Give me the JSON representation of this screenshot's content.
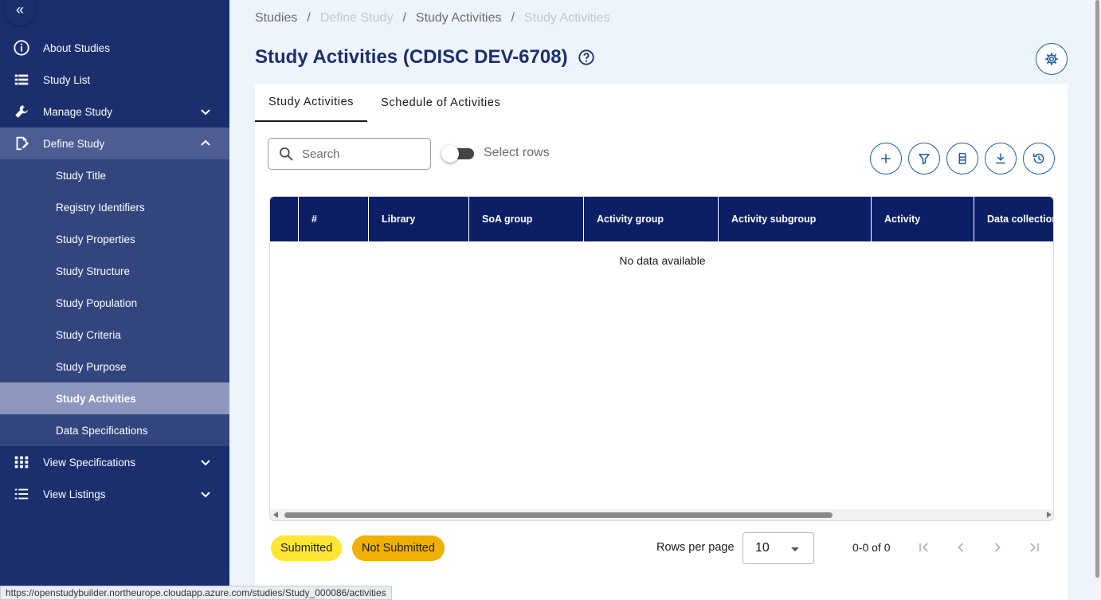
{
  "sidebar": {
    "collapse_icon": "chevron-double-left-icon",
    "items": [
      {
        "label": "About Studies",
        "icon": "info-icon"
      },
      {
        "label": "Study List",
        "icon": "list-icon"
      },
      {
        "label": "Manage Study",
        "icon": "wrench-icon"
      },
      {
        "label": "Define Study",
        "icon": "edit-document-icon"
      },
      {
        "label": "View Specifications",
        "icon": "grid-icon"
      },
      {
        "label": "View Listings",
        "icon": "list-bullets-icon"
      }
    ],
    "sub_items": [
      {
        "label": "Study Title"
      },
      {
        "label": "Registry Identifiers"
      },
      {
        "label": "Study Properties"
      },
      {
        "label": "Study Structure"
      },
      {
        "label": "Study Population"
      },
      {
        "label": "Study Criteria"
      },
      {
        "label": "Study Purpose"
      },
      {
        "label": "Study Activities"
      },
      {
        "label": "Data Specifications"
      }
    ]
  },
  "breadcrumb": [
    "Studies",
    "Define Study",
    "Study Activities",
    "Study Activities"
  ],
  "page": {
    "title": "Study Activities (CDISC DEV-6708)"
  },
  "tabs": [
    "Study Activities",
    "Schedule of Activities"
  ],
  "search": {
    "placeholder": "Search"
  },
  "toggle": {
    "label": "Select rows"
  },
  "table": {
    "columns": [
      "",
      "#",
      "Library",
      "SoA group",
      "Activity group",
      "Activity subgroup",
      "Activity",
      "Data collection"
    ],
    "empty_text": "No data available"
  },
  "legend": {
    "submitted": "Submitted",
    "not_submitted": "Not Submitted"
  },
  "pagination": {
    "rows_per_page_label": "Rows per page",
    "rows_per_page": "10",
    "range": "0-0 of 0"
  },
  "status_url": "https://openstudybuilder.northeurope.cloudapp.azure.com/studies/Study_000086/activities",
  "colors": {
    "sidebar": "#1b2f6e",
    "accent": "#1b5fae",
    "header": "#0c1f66",
    "submitted": "#ffe633",
    "not_submitted": "#f0b000"
  }
}
